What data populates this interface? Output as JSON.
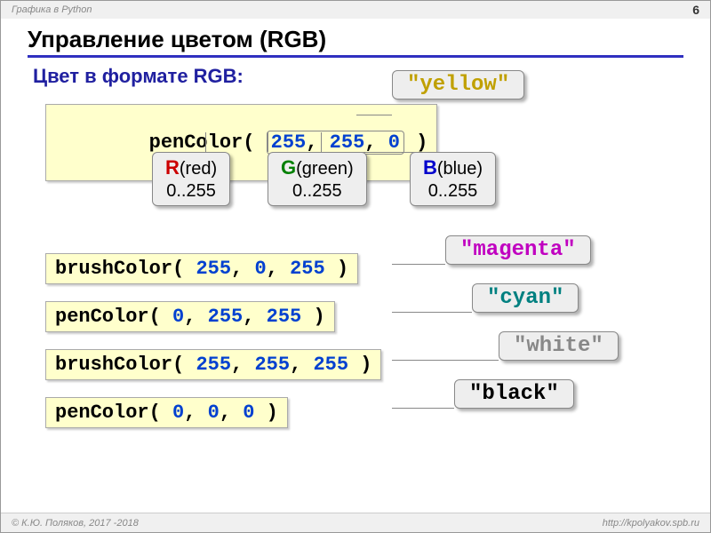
{
  "header": {
    "breadcrumb": "Графика в Python",
    "page": "6"
  },
  "title": "Управление цветом (RGB)",
  "subtitle": "Цвет в формате RGB:",
  "example1": {
    "fn": "penColor",
    "r": "255",
    "g": "255",
    "b": "0",
    "name": "\"yellow\"",
    "color": "#c0a000"
  },
  "components": {
    "r": {
      "letter": "R",
      "word": "(red)",
      "range": "0..255",
      "color": "#cc0000"
    },
    "g": {
      "letter": "G",
      "word": "(green)",
      "range": "0..255",
      "color": "#008000"
    },
    "b": {
      "letter": "B",
      "word": "(blue)",
      "range": "0..255",
      "color": "#0000cc"
    }
  },
  "rows": [
    {
      "fn": "brushColor",
      "r": "255",
      "g": "0",
      "b": "255",
      "name": "\"magenta\"",
      "color": "#c000c0"
    },
    {
      "fn": "penColor",
      "r": "0",
      "g": "255",
      "b": "255",
      "name": "\"cyan\"",
      "color": "#008080"
    },
    {
      "fn": "brushColor",
      "r": "255",
      "g": "255",
      "b": "255",
      "name": "\"white\"",
      "color": "#888888"
    },
    {
      "fn": "penColor",
      "r": "0",
      "g": "0",
      "b": "0",
      "name": "\"black\"",
      "color": "#000000"
    }
  ],
  "footer": {
    "copyright": "© К.Ю. Поляков, 2017 -2018",
    "url": "http://kpolyakov.spb.ru"
  }
}
